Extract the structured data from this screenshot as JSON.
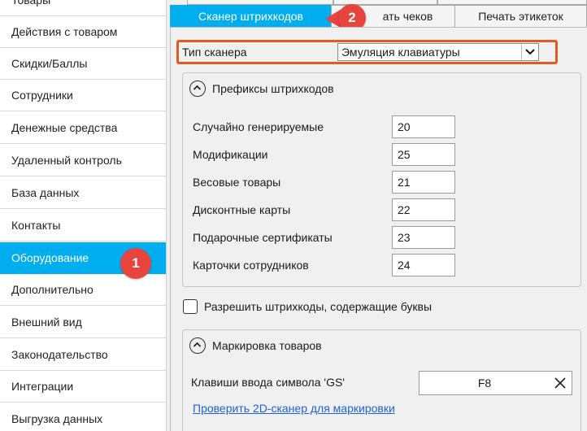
{
  "sidebar": {
    "items": [
      {
        "label": "Товары"
      },
      {
        "label": "Действия с товаром"
      },
      {
        "label": "Скидки/Баллы"
      },
      {
        "label": "Сотрудники"
      },
      {
        "label": "Денежные средства"
      },
      {
        "label": "Удаленный контроль"
      },
      {
        "label": "База данных"
      },
      {
        "label": "Контакты"
      },
      {
        "label": "Оборудование"
      },
      {
        "label": "Дополнительно"
      },
      {
        "label": "Внешний вид"
      },
      {
        "label": "Законодательство"
      },
      {
        "label": "Интеграции"
      },
      {
        "label": "Выгрузка данных"
      }
    ],
    "active_index": 8,
    "active_color": "#00aeef"
  },
  "badges": {
    "sidebar_step": "1",
    "tab_step": "2",
    "color": "#e8443e"
  },
  "tabs": [
    {
      "label": "Сканер штрихкодов",
      "active": true
    },
    {
      "label": "ать чеков",
      "active": false
    },
    {
      "label": "Печать этикеток",
      "active": false
    }
  ],
  "scanner": {
    "label": "Тип сканера",
    "value": "Эмуляция клавиатуры",
    "highlight_color": "#e35a1c"
  },
  "prefixes": {
    "title": "Префиксы штрихкодов",
    "fields": [
      {
        "label": "Случайно генерируемые",
        "value": "20"
      },
      {
        "label": "Модификации",
        "value": "25"
      },
      {
        "label": "Весовые товары",
        "value": "21"
      },
      {
        "label": "Дисконтные карты",
        "value": "22"
      },
      {
        "label": "Подарочные сертификаты",
        "value": "23"
      },
      {
        "label": "Карточки сотрудников",
        "value": "24"
      }
    ]
  },
  "allow_letters": {
    "label": "Разрешить штрихкоды, содержащие буквы",
    "checked": false
  },
  "marking": {
    "title": "Маркировка товаров",
    "gs_label": "Клавиши ввода символа 'GS'",
    "gs_value": "F8",
    "check_link": "Проверить 2D-сканер для маркировки"
  }
}
